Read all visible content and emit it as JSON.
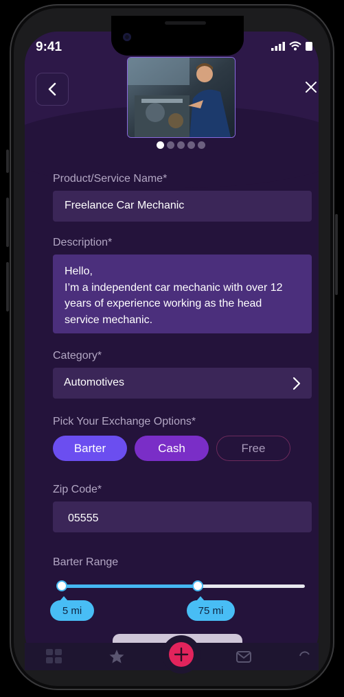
{
  "status_bar": {
    "time": "9:41"
  },
  "header": {
    "back_icon": "chevron-left-icon",
    "close_icon": "close-icon",
    "photo_dots_count": 5,
    "active_dot": 0
  },
  "form": {
    "name_label": "Product/Service Name*",
    "name_value": "Freelance Car Mechanic",
    "description_label": "Description*",
    "description_lines": [
      "Hello,",
      "I’m a independent car mechanic with over 12",
      "years of experience working as the head",
      "service mechanic."
    ],
    "category_label": "Category*",
    "category_value": "Automotives",
    "exchange_label": "Pick Your Exchange Options*",
    "exchange_options": [
      "Barter",
      "Cash",
      "Free"
    ],
    "zip_label": "Zip Code*",
    "zip_value": "05555",
    "range_label": "Barter Range",
    "range_min_label": "5 mi",
    "range_max_label": "75 mi",
    "range_min_value": 5,
    "range_max_value": 75
  },
  "colors": {
    "barter": "#6b4ef0",
    "cash": "#7a2ec7",
    "slider": "#45b8f2",
    "fab": "#e2245c"
  },
  "tabbar": {
    "icons": [
      "grid-icon",
      "star-icon",
      "plus-icon",
      "mail-icon",
      "refresh-icon"
    ]
  }
}
